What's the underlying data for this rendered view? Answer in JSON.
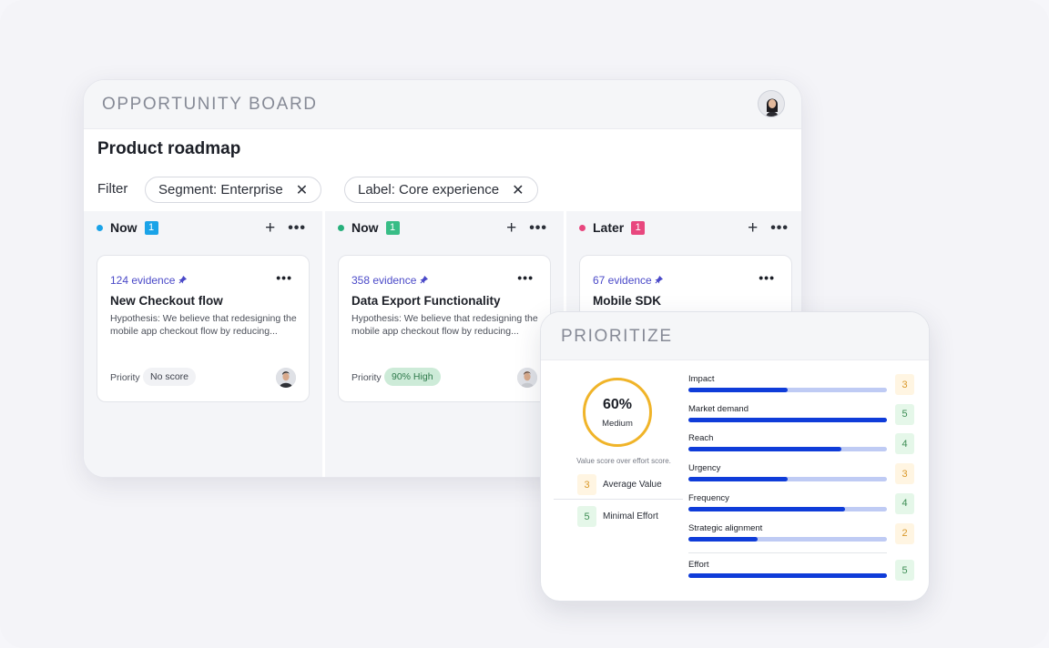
{
  "board": {
    "title": "OPPORTUNITY BOARD",
    "heading": "Product roadmap",
    "filter_label": "Filter",
    "filters": [
      {
        "label": "Segment: Enterprise",
        "remove_icon": "close-icon"
      },
      {
        "label": "Label: Core experience",
        "remove_icon": "close-icon"
      }
    ],
    "columns": [
      {
        "name": "Now",
        "count": "1",
        "dot_color": "#1aa3e8",
        "count_color": "#1aa3e8",
        "card": {
          "evidence": "124 evidence",
          "title": "New Checkout flow",
          "description": "Hypothesis: We believe that redesigning the mobile app checkout flow by reducing...",
          "priority_label": "Priority",
          "priority_value": "No score",
          "priority_bg": "#f1f2f5",
          "priority_color": "#3d414b"
        }
      },
      {
        "name": "Now",
        "count": "1",
        "dot_color": "#27b07c",
        "count_color": "#38bd86",
        "card": {
          "evidence": "358 evidence",
          "title": "Data Export Functionality",
          "description": "Hypothesis: We believe that redesigning the mobile app checkout flow by reducing...",
          "priority_label": "Priority",
          "priority_value": "90% High",
          "priority_bg": "#cdebd8",
          "priority_color": "#2f7a4c"
        }
      },
      {
        "name": "Later",
        "count": "1",
        "dot_color": "#e8477e",
        "count_color": "#e8477e",
        "card": {
          "evidence": "67 evidence",
          "title": "Mobile SDK",
          "description": "",
          "priority_label": "",
          "priority_value": "",
          "priority_bg": "#ffffff",
          "priority_color": "#ffffff"
        }
      }
    ],
    "add_glyph": "+",
    "more_glyph": "•••",
    "evidence_icon": "pin-icon"
  },
  "prioritize": {
    "title": "PRIORITIZE",
    "gauge_value": "60%",
    "gauge_label": "Medium",
    "gauge_fraction": 0.6,
    "note": "Value score over effort score.",
    "summary": [
      {
        "score": "3",
        "label": "Average Value",
        "tone": "amber"
      },
      {
        "score": "5",
        "label": "Minimal Effort",
        "tone": "green"
      }
    ],
    "metrics": [
      {
        "name": "Impact",
        "score": "3",
        "fraction": 0.5,
        "tone": "amber"
      },
      {
        "name": "Market demand",
        "score": "5",
        "fraction": 1.0,
        "tone": "green"
      },
      {
        "name": "Reach",
        "score": "4",
        "fraction": 0.77,
        "tone": "green"
      },
      {
        "name": "Urgency",
        "score": "3",
        "fraction": 0.5,
        "tone": "amber"
      },
      {
        "name": "Frequency",
        "score": "4",
        "fraction": 0.79,
        "tone": "green"
      },
      {
        "name": "Strategic alignment",
        "score": "2",
        "fraction": 0.35,
        "tone": "amber"
      },
      {
        "name": "Effort",
        "score": "5",
        "fraction": 1.0,
        "tone": "green"
      }
    ]
  }
}
